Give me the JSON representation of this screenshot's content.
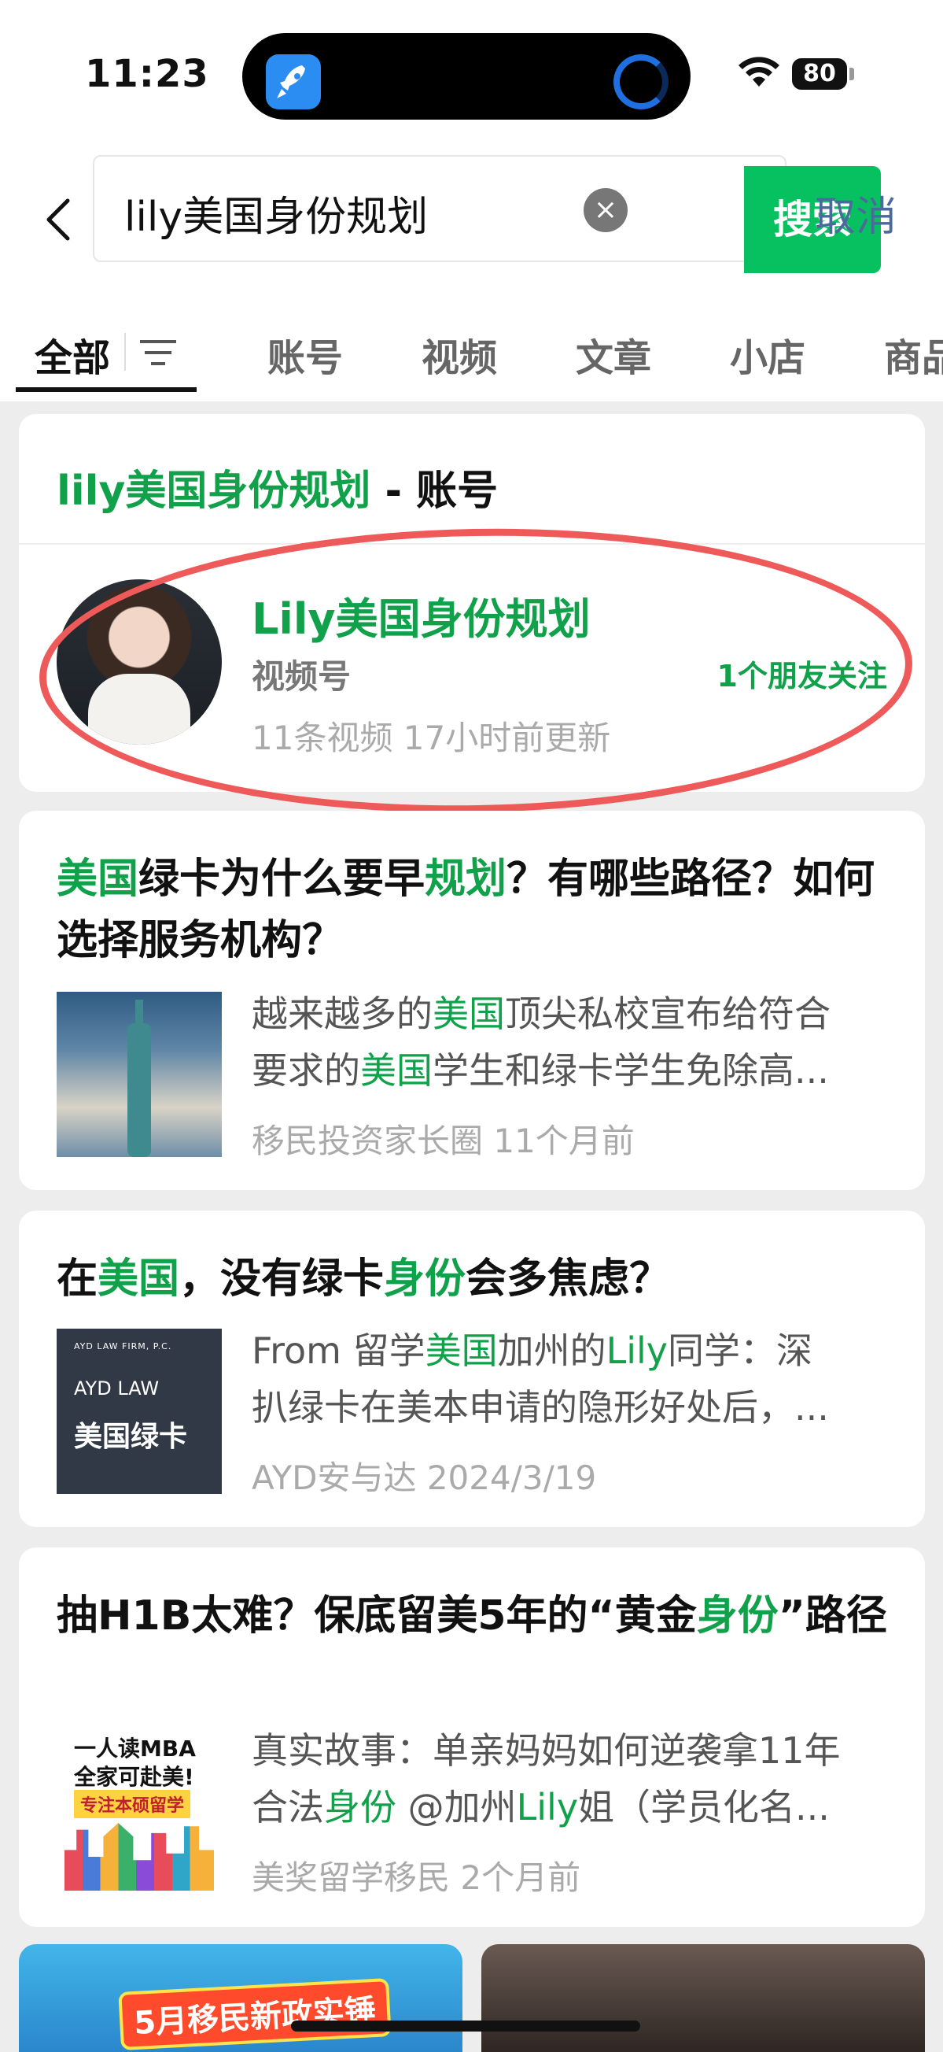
{
  "status_bar": {
    "time": "11:23",
    "battery": "80"
  },
  "search": {
    "query": "lily美国身份规划",
    "search_button": "搜索",
    "cancel": "取消"
  },
  "tabs": [
    "全部",
    "账号",
    "视频",
    "文章",
    "小店",
    "商品"
  ],
  "account_section": {
    "title_highlight": "lily美国身份规划",
    "title_suffix": " - 账号",
    "name": "Lily美国身份规划",
    "type": "视频号",
    "friends": "1个朋友关注",
    "meta": "11条视频  17小时前更新"
  },
  "articles": [
    {
      "title_parts": [
        [
          "美国",
          true
        ],
        [
          "绿卡为什么要早",
          false
        ],
        [
          "规划",
          true
        ],
        [
          "？有哪些路径？如何选择服务机构？",
          false
        ]
      ],
      "desc_line1": [
        [
          "越来越多的",
          false
        ],
        [
          "美国",
          true
        ],
        [
          "顶尖私校宣布给符合",
          false
        ]
      ],
      "desc_line2": [
        [
          "要求的",
          false
        ],
        [
          "美国",
          true
        ],
        [
          "学生和绿卡学生免除高...",
          false
        ]
      ],
      "meta": "移民投资家长圈  11个月前"
    },
    {
      "title_parts": [
        [
          "在",
          false
        ],
        [
          "美国",
          true
        ],
        [
          "，没有绿卡",
          false
        ],
        [
          "身份",
          true
        ],
        [
          "会多焦虑？",
          false
        ]
      ],
      "desc_line1": [
        [
          "From 留学",
          false
        ],
        [
          "美国",
          true
        ],
        [
          "加州的",
          false
        ],
        [
          "Lily",
          true
        ],
        [
          "同学：深",
          false
        ]
      ],
      "desc_line2": [
        [
          "扒绿卡在美本申请的隐形好处后，...",
          false
        ]
      ],
      "meta": "AYD安与达  2024/3/19",
      "thumb": {
        "small": "AYD LAW FIRM, P.C.",
        "logo": "AYD LAW",
        "big": "美国绿卡"
      }
    },
    {
      "title_parts": [
        [
          "抽H1B太难？保底留美5年的“黄金",
          false
        ],
        [
          "身份",
          true
        ],
        [
          "”路径",
          false
        ]
      ],
      "desc_line1": [
        [
          "真实故事：单亲妈妈如何逆袭拿11年",
          false
        ]
      ],
      "desc_line2": [
        [
          "合法",
          false
        ],
        [
          "身份",
          true
        ],
        [
          " @加州",
          false
        ],
        [
          "Lily",
          true
        ],
        [
          "姐（学员化名...",
          false
        ]
      ],
      "meta": "美奖留学移民  2个月前",
      "thumb": {
        "l1": "一人读MBA",
        "l2": "全家可赴美!",
        "tag": "专注本硕留学"
      }
    }
  ],
  "bottom": {
    "banner": "5月移民新政实锤"
  },
  "colors": {
    "highlight": "#10a14a",
    "search_button": "#07c160",
    "annotation": "#ee5a5a"
  }
}
